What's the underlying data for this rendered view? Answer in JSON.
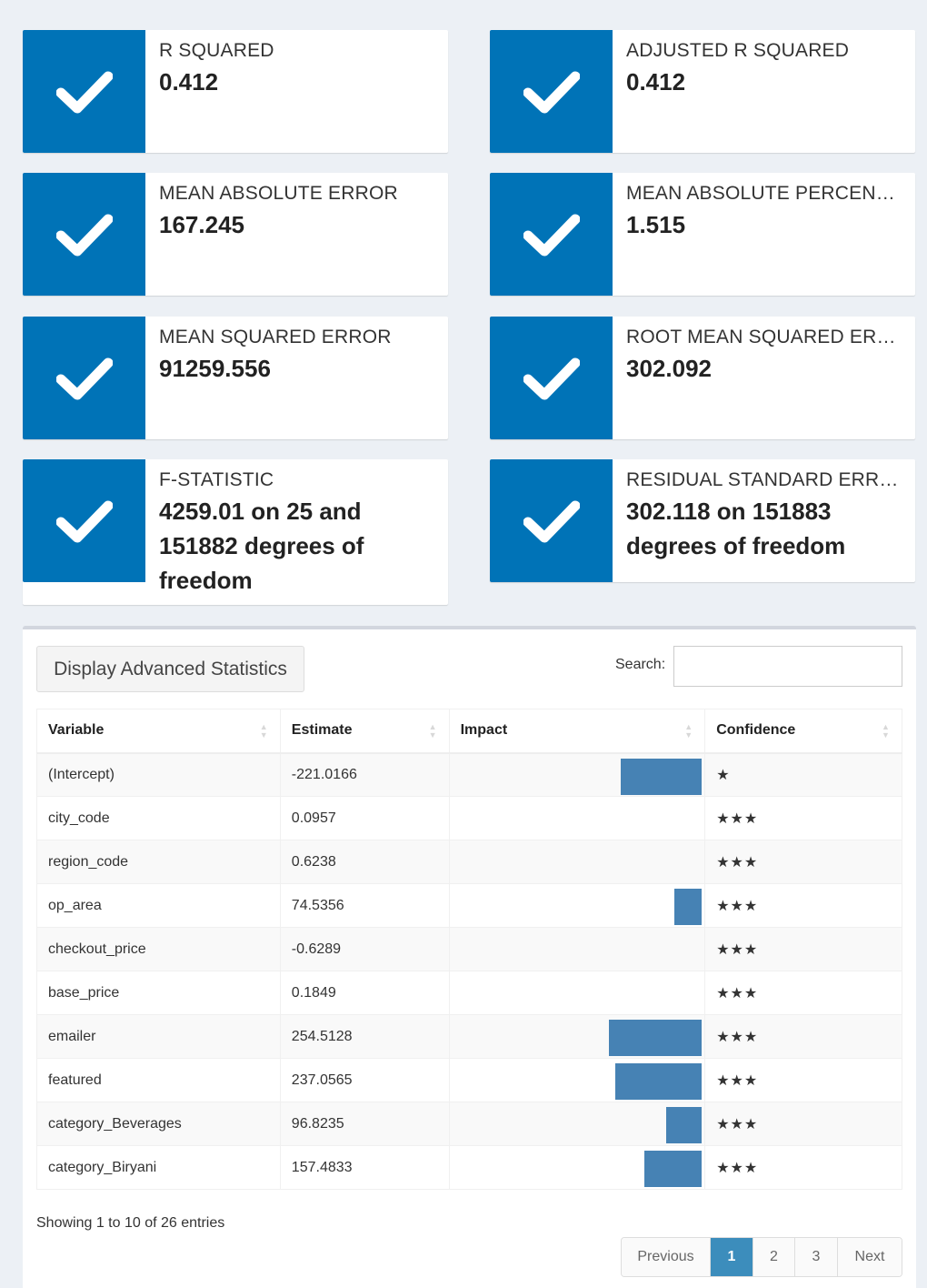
{
  "metrics": [
    {
      "label": "R SQUARED",
      "value": "0.412",
      "icon": "checkmark-icon"
    },
    {
      "label": "ADJUSTED R SQUARED",
      "value": "0.412",
      "icon": "checkmark-icon"
    },
    {
      "label": "MEAN ABSOLUTE ERROR",
      "value": "167.245",
      "icon": "checkmark-icon"
    },
    {
      "label": "MEAN ABSOLUTE PERCENTAGE ERROR",
      "value": "1.515",
      "icon": "checkmark-icon"
    },
    {
      "label": "MEAN SQUARED ERROR",
      "value": "91259.556",
      "icon": "checkmark-icon"
    },
    {
      "label": "ROOT MEAN SQUARED ERROR",
      "value": "302.092",
      "icon": "checkmark-icon"
    },
    {
      "label": "F-STATISTIC",
      "value": "4259.01 on 25 and 151882 degrees of freedom",
      "icon": "checkmark-icon"
    },
    {
      "label": "RESIDUAL STANDARD ERROR",
      "value": "302.118 on 151883 degrees of freedom",
      "icon": "checkmark-icon"
    }
  ],
  "colors": {
    "accent": "#0073b7",
    "bar": "#4682b4",
    "active_page": "#3c8dbc",
    "background": "#ecf0f5"
  },
  "advanced_button": "Display Advanced Statistics",
  "search": {
    "label": "Search:",
    "value": ""
  },
  "table": {
    "headers": {
      "variable": "Variable",
      "estimate": "Estimate",
      "impact": "Impact",
      "confidence": "Confidence"
    },
    "rows": [
      {
        "variable": "(Intercept)",
        "estimate": "-221.0166",
        "impact": 221.0166,
        "confidence": "★"
      },
      {
        "variable": "city_code",
        "estimate": "0.0957",
        "impact": 0.0957,
        "confidence": "★★★"
      },
      {
        "variable": "region_code",
        "estimate": "0.6238",
        "impact": 0.6238,
        "confidence": "★★★"
      },
      {
        "variable": "op_area",
        "estimate": "74.5356",
        "impact": 74.5356,
        "confidence": "★★★"
      },
      {
        "variable": "checkout_price",
        "estimate": "-0.6289",
        "impact": 0.6289,
        "confidence": "★★★"
      },
      {
        "variable": "base_price",
        "estimate": "0.1849",
        "impact": 0.1849,
        "confidence": "★★★"
      },
      {
        "variable": "emailer",
        "estimate": "254.5128",
        "impact": 254.5128,
        "confidence": "★★★"
      },
      {
        "variable": "featured",
        "estimate": "237.0565",
        "impact": 237.0565,
        "confidence": "★★★"
      },
      {
        "variable": "category_Beverages",
        "estimate": "96.8235",
        "impact": 96.8235,
        "confidence": "★★★"
      },
      {
        "variable": "category_Biryani",
        "estimate": "157.4833",
        "impact": 157.4833,
        "confidence": "★★★"
      }
    ]
  },
  "footer": {
    "info": "Showing 1 to 10 of 26 entries",
    "pagination": [
      "Previous",
      "1",
      "2",
      "3",
      "Next"
    ],
    "active_page": "1"
  }
}
